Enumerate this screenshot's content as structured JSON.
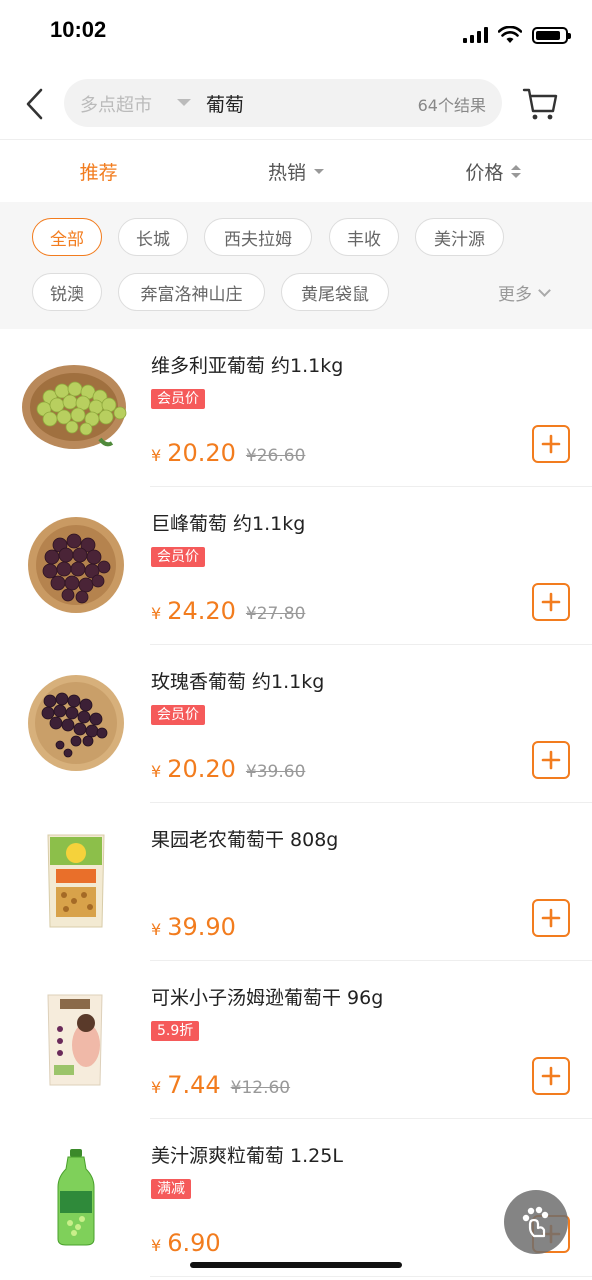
{
  "status_bar": {
    "time": "10:02",
    "battery_level": 0.85
  },
  "search": {
    "scope": "多点超市",
    "query": "葡萄",
    "result_count": "64个结果"
  },
  "sort_tabs": [
    {
      "label": "推荐",
      "active": true
    },
    {
      "label": "热销",
      "active": false
    },
    {
      "label": "价格",
      "active": false
    }
  ],
  "brand_filters": [
    "全部",
    "长城",
    "西夫拉姆",
    "丰收",
    "美汁源",
    "锐澳",
    "奔富洛神山庄",
    "黄尾袋鼠"
  ],
  "more_label": "更多",
  "products": [
    {
      "name": "维多利亚葡萄 约1.1kg",
      "tag": "会员价",
      "currency": "¥",
      "price": "20.20",
      "original": "¥26.60",
      "image": "green-grapes-basket"
    },
    {
      "name": "巨峰葡萄 约1.1kg",
      "tag": "会员价",
      "currency": "¥",
      "price": "24.20",
      "original": "¥27.80",
      "image": "dark-grapes-plate"
    },
    {
      "name": "玫瑰香葡萄 约1.1kg",
      "tag": "会员价",
      "currency": "¥",
      "price": "20.20",
      "original": "¥39.60",
      "image": "rose-grapes-plate"
    },
    {
      "name": "果园老农葡萄干 808g",
      "tag": "",
      "currency": "¥",
      "price": "39.90",
      "original": "",
      "image": "raisin-bag"
    },
    {
      "name": "可米小子汤姆逊葡萄干 96g",
      "tag": "5.9折",
      "currency": "¥",
      "price": "7.44",
      "original": "¥12.60",
      "image": "raisin-pouch"
    },
    {
      "name": "美汁源爽粒葡萄 1.25L",
      "tag": "满减",
      "currency": "¥",
      "price": "6.90",
      "original": "",
      "image": "juice-bottle"
    }
  ],
  "colors": {
    "accent": "#f27c1e",
    "tag_red": "#f55a5a"
  }
}
